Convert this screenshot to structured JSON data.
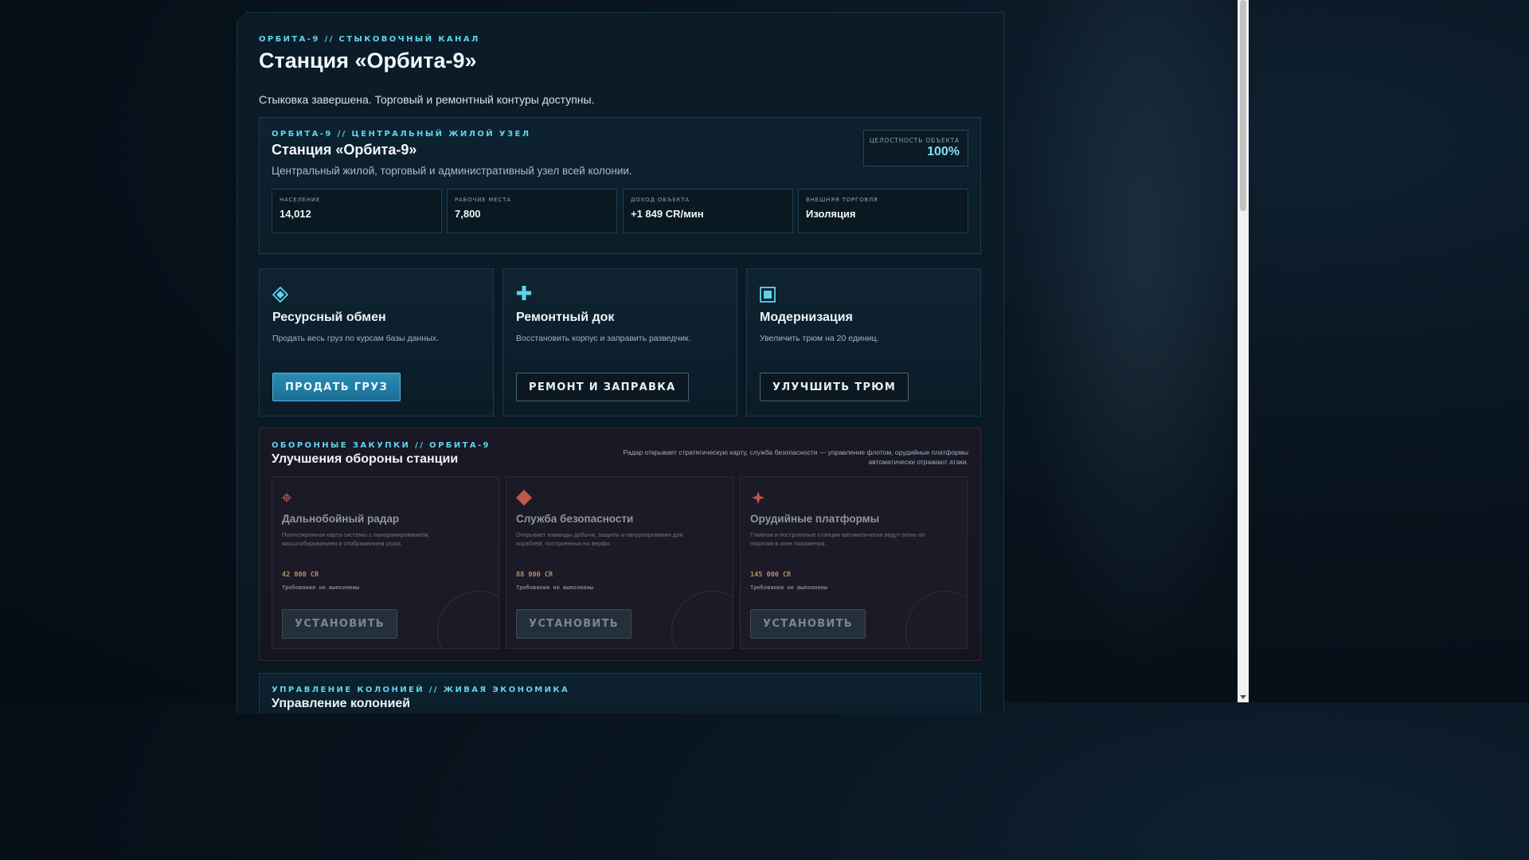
{
  "header": {
    "eyebrow": "ОРБИТА-9 // СТЫКОВОЧНЫЙ КАНАЛ",
    "title": "Станция «Орбита-9»",
    "status": "Стыковка завершена. Торговый и ремонтный контуры доступны."
  },
  "hub": {
    "eyebrow": "ОРБИТА-9 // ЦЕНТРАЛЬНЫЙ ЖИЛОЙ УЗЕЛ",
    "title": "Станция «Орбита-9»",
    "description": "Центральный жилой, торговый и административный узел всей колонии.",
    "integrity_label": "ЦЕЛОСТНОСТЬ ОБЪЕКТА",
    "integrity_value": "100%",
    "stats": [
      {
        "label": "НАСЕЛЕНИЕ",
        "value": "14,012"
      },
      {
        "label": "РАБОЧИЕ МЕСТА",
        "value": "7,800"
      },
      {
        "label": "ДОХОД ОБЪЕКТА",
        "value": "+1 849 CR/мин"
      },
      {
        "label": "ВНЕШНЯЯ ТОРГОВЛЯ",
        "value": "Изоляция"
      }
    ]
  },
  "services": [
    {
      "icon": "diamond-icon",
      "title": "Ресурсный обмен",
      "description": "Продать весь груз по курсам базы данных.",
      "button": "ПРОДАТЬ ГРУЗ"
    },
    {
      "icon": "plus-icon",
      "title": "Ремонтный док",
      "description": "Восстановить корпус и заправить разведчик.",
      "button": "РЕМОНТ И ЗАПРАВКА"
    },
    {
      "icon": "module-icon",
      "title": "Модернизация",
      "description": "Увеличить трюм на 20 единиц.",
      "button": "УЛУЧШИТЬ ТРЮМ"
    }
  ],
  "defense": {
    "eyebrow": "ОБОРОННЫЕ ЗАКУПКИ // ОРБИТА-9",
    "title": "Улучшения обороны станции",
    "note": "Радар открывает стратегическую карту, служба безопасности — управление флотом, орудийные платформы автоматически отражают атаки.",
    "items": [
      {
        "icon": "radar-icon",
        "title": "Дальнобойный радар",
        "description": "Полноэкранная карта системы с панорамированием, масштабированием и отображением угроз.",
        "price": "42 000 CR",
        "requirement": "Требования не выполнены",
        "button": "УСТАНОВИТЬ"
      },
      {
        "icon": "security-icon",
        "title": "Служба безопасности",
        "description": "Открывает команды добычи, защиты и патрулирования для кораблей, построенных на верфи.",
        "price": "88 000 CR",
        "requirement": "Требования не выполнены",
        "button": "УСТАНОВИТЬ"
      },
      {
        "icon": "turret-icon",
        "title": "Орудийные платформы",
        "description": "Главная и построенные станции автоматически ведут огонь по пиратам в зоне поражения.",
        "price": "145 000 CR",
        "requirement": "Требования не выполнены",
        "button": "УСТАНОВИТЬ"
      }
    ]
  },
  "colony": {
    "eyebrow": "УПРАВЛЕНИЕ КОЛОНИЕЙ // ЖИВАЯ ЭКОНОМИКА",
    "title": "Управление колонией"
  },
  "colors": {
    "accent": "#5fd3ee",
    "primary_button": "#1f7fa8",
    "defense_price": "#b48a63",
    "defense_icon": "#c2564a"
  }
}
